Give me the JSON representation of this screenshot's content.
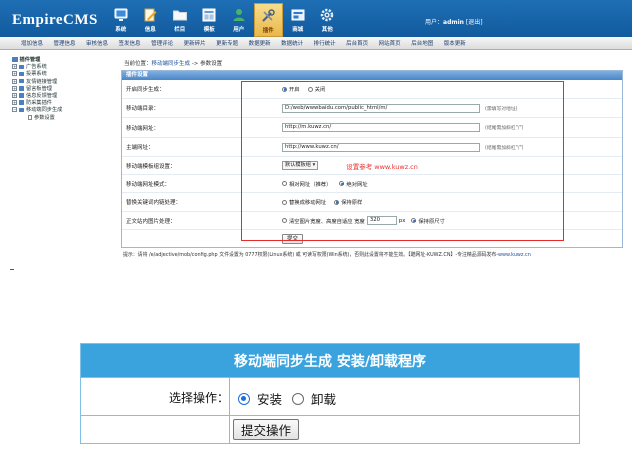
{
  "header": {
    "logo_main": "EmpireCMS",
    "nav": [
      {
        "label": "系统",
        "icon": "computer-icon"
      },
      {
        "label": "信息",
        "icon": "edit-icon"
      },
      {
        "label": "栏目",
        "icon": "folder-icon"
      },
      {
        "label": "模板",
        "icon": "template-icon"
      },
      {
        "label": "用户",
        "icon": "user-icon"
      },
      {
        "label": "插件",
        "icon": "tools-icon",
        "active": true
      },
      {
        "label": "商城",
        "icon": "shop-icon"
      },
      {
        "label": "其他",
        "icon": "gear-icon"
      }
    ],
    "user_prefix": "用户：",
    "user_name": "admin",
    "logout": "[退出]"
  },
  "menubar": [
    "增加信息",
    "管理信息",
    "审核信息",
    "签发信息",
    "管理评论",
    "更新碎片",
    "更新专题",
    "数据更新",
    "数据统计",
    "排行统计",
    "后台首页",
    "网站首页",
    "后台地图",
    "版本更新"
  ],
  "tree": {
    "root": "插件管理",
    "items": [
      "广告系统",
      "投票系统",
      "友情链接管理",
      "留言板管理",
      "信息反馈管理",
      "防采集插件",
      "移动端同步生成"
    ],
    "sub_item": "参数设置"
  },
  "breadcrumb": {
    "prefix": "当前位置：",
    "link": "移动端同步生成",
    "sep": " -> ",
    "current": "参数设置"
  },
  "panel": {
    "title": "插件设置",
    "rows": {
      "sync": {
        "label": "开启同步生成：",
        "on": "开启",
        "off": "关闭"
      },
      "dir": {
        "label": "移动端目录：",
        "value": "D:/web/wwwbaidu.com/public_html/m/",
        "hint": "(需填写对地址)"
      },
      "murl": {
        "label": "移动端网址：",
        "value": "http://m.kuwz.cn/",
        "hint": "(结尾需加斜杠\"/\")"
      },
      "url": {
        "label": "主端网址：",
        "value": "http://www.kuwz.cn/",
        "hint": "(结尾需加斜杠\"/\")"
      },
      "tpl": {
        "label": "移动端模板组设置：",
        "select": "默认模板组",
        "tip": "设置参考 www.kuwz.cn"
      },
      "mode": {
        "label": "移动端网址模式：",
        "opt1": "相对网址（推荐）",
        "opt2": "绝对网址"
      },
      "replace": {
        "label": "替换关键词内链处理：",
        "opt1": "替换成移动网址",
        "opt2": "保持原样"
      },
      "img": {
        "label": "正文站内图片处理：",
        "opt1": "清空图片宽度、高度自适应 宽度",
        "width": "320",
        "unit": "px",
        "opt2": "保持原尺寸"
      },
      "submit": "提交"
    }
  },
  "footnote": {
    "text": "提示：请将 /e/adjective/mob/config.php 文件设置为 0777权限(Linux系统) 或 可读写权限(Win系统)，否则此设置将不能生效。【酷网址-KUWZ.CN】-专注精品源码发布-",
    "link": "www.kuwz.cn"
  },
  "install": {
    "title": "移动端同步生成 安装/卸载程序",
    "label": "选择操作：",
    "opt_install": "安装",
    "opt_uninstall": "卸载",
    "submit": "提交操作"
  },
  "colors": {
    "header": "#1e6fb5",
    "install_header": "#3aa2dd",
    "highlight": "#e52c2a"
  }
}
